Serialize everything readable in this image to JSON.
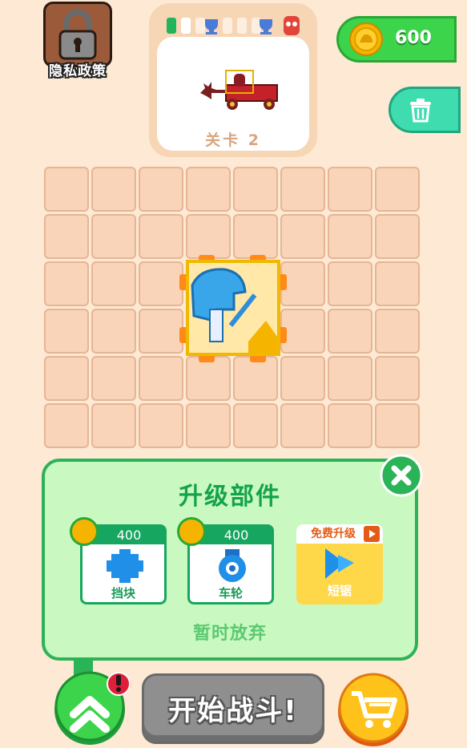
{
  "privacy": {
    "label": "隐私政策"
  },
  "level": {
    "label": "关卡 2",
    "progress_segments": 5,
    "current_segment": 1
  },
  "coins": {
    "value": "600"
  },
  "grid": {
    "rows": 6,
    "cols": 8
  },
  "upgrade_panel": {
    "title": "升级部件",
    "cards": [
      {
        "price": "400",
        "name": "挡块",
        "icon": "block-part-icon"
      },
      {
        "price": "400",
        "name": "车轮",
        "icon": "wheel-part-icon"
      }
    ],
    "free_card": {
      "banner": "免费升级",
      "name": "短锯",
      "icon": "saw-part-icon"
    },
    "give_up": "暂时放弃"
  },
  "bottom": {
    "battle": "开始战斗!"
  },
  "colors": {
    "background": "#fde9d4",
    "green": "#3bd44a",
    "panel": "#c9f9c0",
    "gold": "#f5b400"
  }
}
